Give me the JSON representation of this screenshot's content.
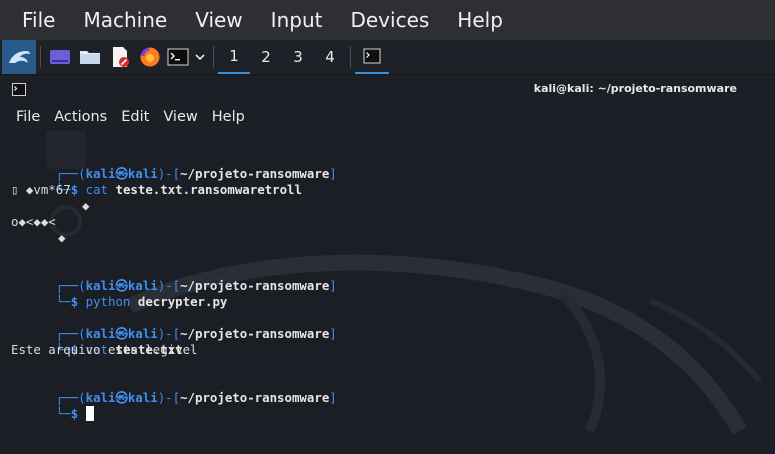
{
  "vbox_menu": [
    "File",
    "Machine",
    "View",
    "Input",
    "Devices",
    "Help"
  ],
  "taskbar": {
    "workspaces": [
      "1",
      "2",
      "3",
      "4"
    ],
    "active_workspace": "1"
  },
  "terminal": {
    "title": "kali@kali: ~/projeto-ransomware",
    "menu": [
      "File",
      "Actions",
      "Edit",
      "View",
      "Help"
    ],
    "prompt": {
      "open": "┌──(",
      "user": "kali",
      "at": "㉿",
      "host": "kali",
      "mid": ")-[",
      "path": "~/projeto-ransomware",
      "close": "]",
      "second_prefix": "└─",
      "dollar": "$"
    },
    "cmd1": {
      "verb": "cat",
      "arg": "teste.txt.ransomwaretroll"
    },
    "garbage1": "▯ ◆vm*67",
    "garbage2": "◆",
    "garbage3": "o◆<◆◆<",
    "garbage4": "◆",
    "cmd2": {
      "verb": "python",
      "arg": "decrypter.py"
    },
    "cmd3": {
      "verb": "cat",
      "arg": "teste.txt"
    },
    "output3": "Este arquivo esta legivel",
    "colors": {
      "prompt_blue": "#3f8ff0",
      "background": "#1b1e25"
    }
  }
}
